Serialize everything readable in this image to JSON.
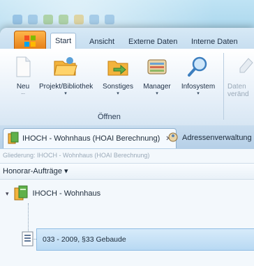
{
  "ribbon_tabs": [
    "Start",
    "Ansicht",
    "Externe Daten",
    "Interne Daten"
  ],
  "ribbon_buttons": [
    {
      "label": "Neu",
      "sub": "..."
    },
    {
      "label": "Projekt/Bibliothek",
      "sub": "▾"
    },
    {
      "label": "Sonstiges",
      "sub": "▾"
    },
    {
      "label": "Manager",
      "sub": "▾"
    },
    {
      "label": "Infosystem",
      "sub": "▾"
    },
    {
      "label": "Daten",
      "sub": "veränd"
    }
  ],
  "ribbon_group_label": "Öffnen",
  "doc_tabs": [
    {
      "label": "IHOCH - Wohnhaus (HOAI Berechnung)",
      "close": "✕"
    },
    {
      "label": "Adressenverwaltung"
    }
  ],
  "breadcrumb": "Gliederung: IHOCH - Wohnhaus (HOAI Berechnung)",
  "filter_label": "Honorar-Aufträge ▾",
  "tree": {
    "root_label": "IHOCH - Wohnhaus",
    "root_expander": "▾",
    "child_label": "033 - 2009, §33 Gebaude"
  },
  "colors": {
    "accent": "#e27a14",
    "selection": "#b8d9f3",
    "ribbon_bg": "#e4eef8"
  }
}
